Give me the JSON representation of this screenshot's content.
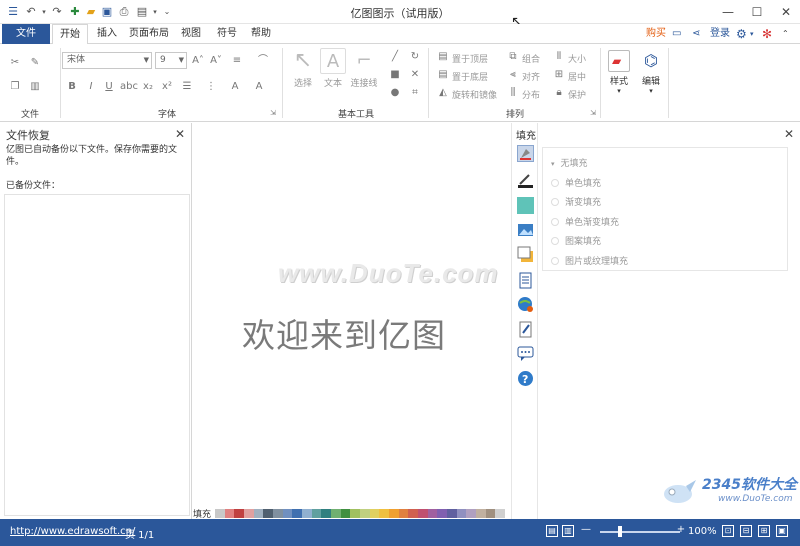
{
  "window": {
    "title": "亿图图示（试用版）",
    "controls": {
      "minimize": "—",
      "maximize": "☐",
      "close": "✕"
    }
  },
  "tabs": {
    "file": "文件",
    "home": "开始",
    "insert": "插入",
    "page_layout": "页面布局",
    "view": "视图",
    "symbols": "符号",
    "help": "帮助",
    "buy": "购买",
    "login": "登录"
  },
  "ribbon": {
    "groups": {
      "file": "文件",
      "font": "字体",
      "basic_tools": "基本工具",
      "arrange": "排列",
      "style": "样式",
      "edit": "编辑"
    },
    "font_name": "宋体",
    "font_size": "9",
    "tools": {
      "select": "选择",
      "text": "文本",
      "connector": "连接线"
    },
    "arrange_items": {
      "bring_front": "置于顶层",
      "send_back": "置于底层",
      "rotate_mirror": "旋转和镜像",
      "group": "组合",
      "align": "对齐",
      "distribute": "分布",
      "size": "大小",
      "center": "居中",
      "protect": "保护"
    },
    "style_btn": "样式",
    "edit_btn": "编辑"
  },
  "recovery_panel": {
    "title": "文件恢复",
    "message": "亿图已自动备份以下文件。保存你需要的文件。",
    "backup_label": "已备份文件："
  },
  "canvas": {
    "welcome": "欢迎来到亿图",
    "watermark": "www.DuoTe.com"
  },
  "color_bar": {
    "label": "填充"
  },
  "fill_panel": {
    "title": "填充",
    "options": [
      "无填充",
      "单色填充",
      "渐变填充",
      "单色渐变填充",
      "图案填充",
      "图片或纹理填充"
    ]
  },
  "status": {
    "url": "http://www.edrawsoft.cn/",
    "page": "页 1/1",
    "zoom": "100%"
  },
  "watermark_logo": {
    "brand": "2345软件大全",
    "url": "www.DuoTe.com"
  },
  "colors": {
    "accent": "#2b579a",
    "welcome_text": "#7a7a7a",
    "status_bar": "#2b579a"
  }
}
